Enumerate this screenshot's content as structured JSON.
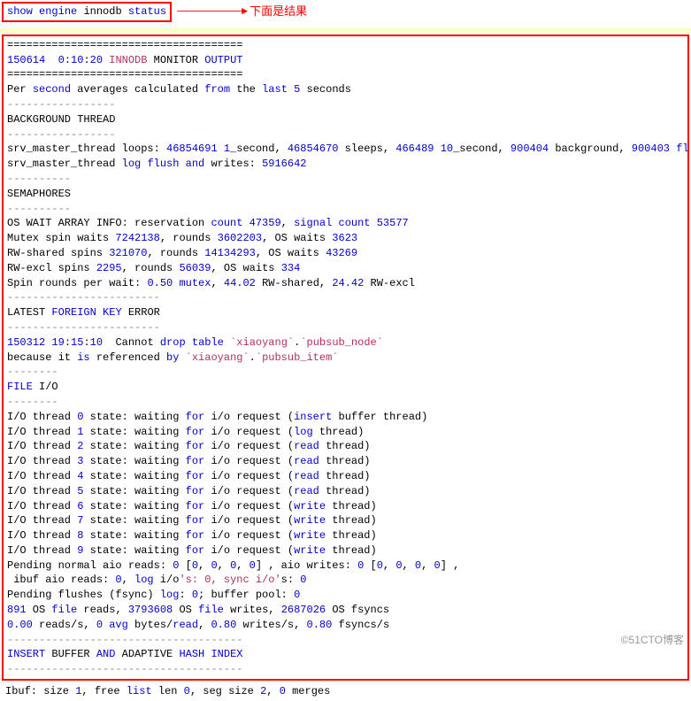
{
  "command": {
    "tokens": [
      {
        "t": "show",
        "c": "kw"
      },
      {
        "t": " "
      },
      {
        "t": "engine",
        "c": "kw"
      },
      {
        "t": " "
      },
      {
        "t": "innodb",
        "c": ""
      },
      {
        "t": " "
      },
      {
        "t": "status",
        "c": "kw"
      }
    ]
  },
  "arrow_label": "下面是结果",
  "watermark": "©51CTO博客",
  "output_lines": [
    [
      {
        "t": "====================================="
      }
    ],
    [
      {
        "t": "150614",
        "c": "num"
      },
      {
        "t": "  "
      },
      {
        "t": "0",
        "c": "num"
      },
      {
        "t": ":"
      },
      {
        "t": "10",
        "c": "num"
      },
      {
        "t": ":"
      },
      {
        "t": "20",
        "c": "num"
      },
      {
        "t": " "
      },
      {
        "t": "INNODB",
        "c": "fn"
      },
      {
        "t": " MONITOR "
      },
      {
        "t": "OUTPUT",
        "c": "kw"
      }
    ],
    [
      {
        "t": "====================================="
      }
    ],
    [
      {
        "t": "Per "
      },
      {
        "t": "second",
        "c": "kw"
      },
      {
        "t": " averages calculated "
      },
      {
        "t": "from",
        "c": "kw"
      },
      {
        "t": " the "
      },
      {
        "t": "last",
        "c": "kw"
      },
      {
        "t": " "
      },
      {
        "t": "5",
        "c": "num"
      },
      {
        "t": " seconds"
      }
    ],
    [
      {
        "t": "-----------------",
        "c": "dim"
      }
    ],
    [
      {
        "t": "BACKGROUND THREAD"
      }
    ],
    [
      {
        "t": "-----------------",
        "c": "dim"
      }
    ],
    [
      {
        "t": "srv_master_thread loops: "
      },
      {
        "t": "46854691",
        "c": "num"
      },
      {
        "t": " "
      },
      {
        "t": "1",
        "c": "num"
      },
      {
        "t": "_second, "
      },
      {
        "t": "46854670",
        "c": "num"
      },
      {
        "t": " sleeps, "
      },
      {
        "t": "466489",
        "c": "num"
      },
      {
        "t": " "
      },
      {
        "t": "10",
        "c": "num"
      },
      {
        "t": "_second, "
      },
      {
        "t": "900404",
        "c": "num"
      },
      {
        "t": " background, "
      },
      {
        "t": "900403",
        "c": "num"
      },
      {
        "t": " "
      },
      {
        "t": "flush",
        "c": "kw"
      }
    ],
    [
      {
        "t": "srv_master_thread "
      },
      {
        "t": "log",
        "c": "kw"
      },
      {
        "t": " "
      },
      {
        "t": "flush",
        "c": "kw"
      },
      {
        "t": " "
      },
      {
        "t": "and",
        "c": "kw"
      },
      {
        "t": " writes: "
      },
      {
        "t": "5916642",
        "c": "num"
      }
    ],
    [
      {
        "t": "----------",
        "c": "dim"
      }
    ],
    [
      {
        "t": "SEMAPHORES"
      }
    ],
    [
      {
        "t": "----------",
        "c": "dim"
      }
    ],
    [
      {
        "t": "OS WAIT ARRAY INFO: reservation "
      },
      {
        "t": "count",
        "c": "kw"
      },
      {
        "t": " "
      },
      {
        "t": "47359",
        "c": "num"
      },
      {
        "t": ", "
      },
      {
        "t": "signal",
        "c": "kw"
      },
      {
        "t": " "
      },
      {
        "t": "count",
        "c": "kw"
      },
      {
        "t": " "
      },
      {
        "t": "53577",
        "c": "num"
      }
    ],
    [
      {
        "t": "Mutex spin waits "
      },
      {
        "t": "7242138",
        "c": "num"
      },
      {
        "t": ", rounds "
      },
      {
        "t": "3602203",
        "c": "num"
      },
      {
        "t": ", OS waits "
      },
      {
        "t": "3623",
        "c": "num"
      }
    ],
    [
      {
        "t": "RW-shared spins "
      },
      {
        "t": "321070",
        "c": "num"
      },
      {
        "t": ", rounds "
      },
      {
        "t": "14134293",
        "c": "num"
      },
      {
        "t": ", OS waits "
      },
      {
        "t": "43269",
        "c": "num"
      }
    ],
    [
      {
        "t": "RW-excl spins "
      },
      {
        "t": "2295",
        "c": "num"
      },
      {
        "t": ", rounds "
      },
      {
        "t": "56039",
        "c": "num"
      },
      {
        "t": ", OS waits "
      },
      {
        "t": "334",
        "c": "num"
      }
    ],
    [
      {
        "t": "Spin rounds per wait: "
      },
      {
        "t": "0.50",
        "c": "num"
      },
      {
        "t": " "
      },
      {
        "t": "mutex",
        "c": "kw"
      },
      {
        "t": ", "
      },
      {
        "t": "44.02",
        "c": "num"
      },
      {
        "t": " RW-shared, "
      },
      {
        "t": "24.42",
        "c": "num"
      },
      {
        "t": " RW-excl"
      }
    ],
    [
      {
        "t": "------------------------",
        "c": "dim"
      }
    ],
    [
      {
        "t": "LATEST "
      },
      {
        "t": "FOREIGN",
        "c": "kw"
      },
      {
        "t": " "
      },
      {
        "t": "KEY",
        "c": "kw"
      },
      {
        "t": " ERROR"
      }
    ],
    [
      {
        "t": "------------------------",
        "c": "dim"
      }
    ],
    [
      {
        "t": "150312",
        "c": "num"
      },
      {
        "t": " "
      },
      {
        "t": "19",
        "c": "num"
      },
      {
        "t": ":"
      },
      {
        "t": "15",
        "c": "num"
      },
      {
        "t": ":"
      },
      {
        "t": "10",
        "c": "num"
      },
      {
        "t": "  Cannot "
      },
      {
        "t": "drop",
        "c": "kw"
      },
      {
        "t": " "
      },
      {
        "t": "table",
        "c": "kw"
      },
      {
        "t": " "
      },
      {
        "t": "`xiaoyang`",
        "c": "lit"
      },
      {
        "t": "."
      },
      {
        "t": "`pubsub_node`",
        "c": "lit"
      }
    ],
    [
      {
        "t": "because it "
      },
      {
        "t": "is",
        "c": "kw"
      },
      {
        "t": " referenced "
      },
      {
        "t": "by",
        "c": "kw"
      },
      {
        "t": " "
      },
      {
        "t": "`xiaoyang`",
        "c": "lit"
      },
      {
        "t": "."
      },
      {
        "t": "`pubsub_item`",
        "c": "lit"
      }
    ],
    [
      {
        "t": "--------",
        "c": "dim"
      }
    ],
    [
      {
        "t": "FILE",
        "c": "kw"
      },
      {
        "t": " I/O"
      }
    ],
    [
      {
        "t": "--------",
        "c": "dim"
      }
    ],
    [
      {
        "t": "I/O thread "
      },
      {
        "t": "0",
        "c": "num"
      },
      {
        "t": " state: waiting "
      },
      {
        "t": "for",
        "c": "kw"
      },
      {
        "t": " i/o request ("
      },
      {
        "t": "insert",
        "c": "kw"
      },
      {
        "t": " buffer thread)"
      }
    ],
    [
      {
        "t": "I/O thread "
      },
      {
        "t": "1",
        "c": "num"
      },
      {
        "t": " state: waiting "
      },
      {
        "t": "for",
        "c": "kw"
      },
      {
        "t": " i/o request ("
      },
      {
        "t": "log",
        "c": "kw"
      },
      {
        "t": " thread)"
      }
    ],
    [
      {
        "t": "I/O thread "
      },
      {
        "t": "2",
        "c": "num"
      },
      {
        "t": " state: waiting "
      },
      {
        "t": "for",
        "c": "kw"
      },
      {
        "t": " i/o request ("
      },
      {
        "t": "read",
        "c": "kw"
      },
      {
        "t": " thread)"
      }
    ],
    [
      {
        "t": "I/O thread "
      },
      {
        "t": "3",
        "c": "num"
      },
      {
        "t": " state: waiting "
      },
      {
        "t": "for",
        "c": "kw"
      },
      {
        "t": " i/o request ("
      },
      {
        "t": "read",
        "c": "kw"
      },
      {
        "t": " thread)"
      }
    ],
    [
      {
        "t": "I/O thread "
      },
      {
        "t": "4",
        "c": "num"
      },
      {
        "t": " state: waiting "
      },
      {
        "t": "for",
        "c": "kw"
      },
      {
        "t": " i/o request ("
      },
      {
        "t": "read",
        "c": "kw"
      },
      {
        "t": " thread)"
      }
    ],
    [
      {
        "t": "I/O thread "
      },
      {
        "t": "5",
        "c": "num"
      },
      {
        "t": " state: waiting "
      },
      {
        "t": "for",
        "c": "kw"
      },
      {
        "t": " i/o request ("
      },
      {
        "t": "read",
        "c": "kw"
      },
      {
        "t": " thread)"
      }
    ],
    [
      {
        "t": "I/O thread "
      },
      {
        "t": "6",
        "c": "num"
      },
      {
        "t": " state: waiting "
      },
      {
        "t": "for",
        "c": "kw"
      },
      {
        "t": " i/o request ("
      },
      {
        "t": "write",
        "c": "kw"
      },
      {
        "t": " thread)"
      }
    ],
    [
      {
        "t": "I/O thread "
      },
      {
        "t": "7",
        "c": "num"
      },
      {
        "t": " state: waiting "
      },
      {
        "t": "for",
        "c": "kw"
      },
      {
        "t": " i/o request ("
      },
      {
        "t": "write",
        "c": "kw"
      },
      {
        "t": " thread)"
      }
    ],
    [
      {
        "t": "I/O thread "
      },
      {
        "t": "8",
        "c": "num"
      },
      {
        "t": " state: waiting "
      },
      {
        "t": "for",
        "c": "kw"
      },
      {
        "t": " i/o request ("
      },
      {
        "t": "write",
        "c": "kw"
      },
      {
        "t": " thread)"
      }
    ],
    [
      {
        "t": "I/O thread "
      },
      {
        "t": "9",
        "c": "num"
      },
      {
        "t": " state: waiting "
      },
      {
        "t": "for",
        "c": "kw"
      },
      {
        "t": " i/o request ("
      },
      {
        "t": "write",
        "c": "kw"
      },
      {
        "t": " thread)"
      }
    ],
    [
      {
        "t": "Pending normal aio reads: "
      },
      {
        "t": "0",
        "c": "num"
      },
      {
        "t": " ["
      },
      {
        "t": "0",
        "c": "num"
      },
      {
        "t": ", "
      },
      {
        "t": "0",
        "c": "num"
      },
      {
        "t": ", "
      },
      {
        "t": "0",
        "c": "num"
      },
      {
        "t": ", "
      },
      {
        "t": "0",
        "c": "num"
      },
      {
        "t": "] , aio writes: "
      },
      {
        "t": "0",
        "c": "num"
      },
      {
        "t": " ["
      },
      {
        "t": "0",
        "c": "num"
      },
      {
        "t": ", "
      },
      {
        "t": "0",
        "c": "num"
      },
      {
        "t": ", "
      },
      {
        "t": "0",
        "c": "num"
      },
      {
        "t": ", "
      },
      {
        "t": "0",
        "c": "num"
      },
      {
        "t": "] ,"
      }
    ],
    [
      {
        "t": " ibuf aio reads: "
      },
      {
        "t": "0",
        "c": "num"
      },
      {
        "t": ", "
      },
      {
        "t": "log",
        "c": "kw"
      },
      {
        "t": " i/o"
      },
      {
        "t": "'s: 0, sync i/o'",
        "c": "lit"
      },
      {
        "t": "s: "
      },
      {
        "t": "0",
        "c": "num"
      }
    ],
    [
      {
        "t": "Pending flushes (fsync) "
      },
      {
        "t": "log",
        "c": "kw"
      },
      {
        "t": ": "
      },
      {
        "t": "0",
        "c": "num"
      },
      {
        "t": "; buffer pool: "
      },
      {
        "t": "0",
        "c": "num"
      }
    ],
    [
      {
        "t": "891",
        "c": "num"
      },
      {
        "t": " OS "
      },
      {
        "t": "file",
        "c": "kw"
      },
      {
        "t": " reads, "
      },
      {
        "t": "3793608",
        "c": "num"
      },
      {
        "t": " OS "
      },
      {
        "t": "file",
        "c": "kw"
      },
      {
        "t": " writes, "
      },
      {
        "t": "2687026",
        "c": "num"
      },
      {
        "t": " OS fsyncs"
      }
    ],
    [
      {
        "t": "0.00",
        "c": "num"
      },
      {
        "t": " reads/s, "
      },
      {
        "t": "0",
        "c": "num"
      },
      {
        "t": " "
      },
      {
        "t": "avg",
        "c": "kw"
      },
      {
        "t": " bytes/"
      },
      {
        "t": "read",
        "c": "kw"
      },
      {
        "t": ", "
      },
      {
        "t": "0.80",
        "c": "num"
      },
      {
        "t": " writes/s, "
      },
      {
        "t": "0.80",
        "c": "num"
      },
      {
        "t": " fsyncs/s"
      }
    ],
    [
      {
        "t": "-------------------------------------",
        "c": "dim"
      }
    ],
    [
      {
        "t": "INSERT",
        "c": "kw"
      },
      {
        "t": " BUFFER "
      },
      {
        "t": "AND",
        "c": "kw"
      },
      {
        "t": " ADAPTIVE "
      },
      {
        "t": "HASH",
        "c": "kw"
      },
      {
        "t": " "
      },
      {
        "t": "INDEX",
        "c": "kw"
      }
    ],
    [
      {
        "t": "-------------------------------------",
        "c": "dim"
      }
    ]
  ],
  "after_lines": [
    [
      {
        "t": "Ibuf: size "
      },
      {
        "t": "1",
        "c": "num"
      },
      {
        "t": ", free "
      },
      {
        "t": "list",
        "c": "kw"
      },
      {
        "t": " len "
      },
      {
        "t": "0",
        "c": "num"
      },
      {
        "t": ", seg size "
      },
      {
        "t": "2",
        "c": "num"
      },
      {
        "t": ", "
      },
      {
        "t": "0",
        "c": "num"
      },
      {
        "t": " merges"
      }
    ]
  ]
}
